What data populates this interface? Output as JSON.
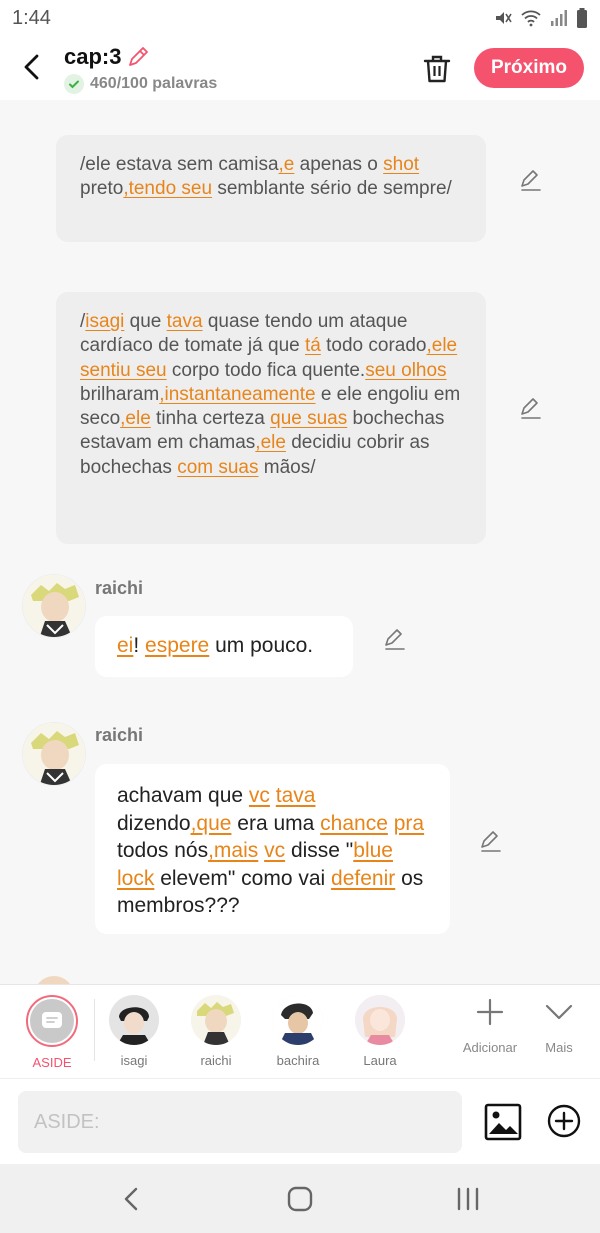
{
  "status_bar": {
    "time": "1:44"
  },
  "header": {
    "title": "cap:3",
    "word_count": "460/100 palavras",
    "next_label": "Próximo"
  },
  "narrations": [
    {
      "segments": [
        {
          "t": "/ele estava sem camisa",
          "h": false
        },
        {
          "t": ",e",
          "h": true
        },
        {
          "t": " apenas o ",
          "h": false
        },
        {
          "t": "shot",
          "h": true
        },
        {
          "t": " preto",
          "h": false
        },
        {
          "t": ",tendo seu",
          "h": true
        },
        {
          "t": " semblante sério de sempre/",
          "h": false
        }
      ]
    },
    {
      "segments": [
        {
          "t": "/",
          "h": false
        },
        {
          "t": "isagi",
          "h": true
        },
        {
          "t": " que ",
          "h": false
        },
        {
          "t": "tava",
          "h": true
        },
        {
          "t": " quase tendo um ataque cardíaco de tomate já que ",
          "h": false
        },
        {
          "t": "tá",
          "h": true
        },
        {
          "t": " todo corado",
          "h": false
        },
        {
          "t": ",ele",
          "h": true
        },
        {
          "t": " ",
          "h": false
        },
        {
          "t": "sentiu seu",
          "h": true
        },
        {
          "t": " corpo todo fica quente.",
          "h": false
        },
        {
          "t": "seu olhos",
          "h": true
        },
        {
          "t": " brilharam",
          "h": false
        },
        {
          "t": ",instantaneamente",
          "h": true
        },
        {
          "t": " e ele engoliu em seco",
          "h": false
        },
        {
          "t": ",ele",
          "h": true
        },
        {
          "t": " tinha certeza ",
          "h": false
        },
        {
          "t": "que suas",
          "h": true
        },
        {
          "t": " bochechas estavam em chamas",
          "h": false
        },
        {
          "t": ",ele",
          "h": true
        },
        {
          "t": " decidiu cobrir as bochechas ",
          "h": false
        },
        {
          "t": "com suas",
          "h": true
        },
        {
          "t": " mãos/",
          "h": false
        }
      ]
    }
  ],
  "messages": [
    {
      "speaker": "raichi",
      "segments": [
        {
          "t": "ei",
          "h": true
        },
        {
          "t": "! ",
          "h": false
        },
        {
          "t": "espere",
          "h": true
        },
        {
          "t": " um pouco.",
          "h": false
        }
      ]
    },
    {
      "speaker": "raichi",
      "segments": [
        {
          "t": "achavam que ",
          "h": false
        },
        {
          "t": "vc",
          "h": true
        },
        {
          "t": " ",
          "h": false
        },
        {
          "t": "tava",
          "h": true
        },
        {
          "t": " dizendo",
          "h": false
        },
        {
          "t": ",que",
          "h": true
        },
        {
          "t": " era uma ",
          "h": false
        },
        {
          "t": "chance",
          "h": true
        },
        {
          "t": " ",
          "h": false
        },
        {
          "t": "pra",
          "h": true
        },
        {
          "t": " todos nós",
          "h": false
        },
        {
          "t": ",mais",
          "h": true
        },
        {
          "t": " ",
          "h": false
        },
        {
          "t": "vc",
          "h": true
        },
        {
          "t": " disse \"",
          "h": false
        },
        {
          "t": "blue",
          "h": true
        },
        {
          "t": " ",
          "h": false
        },
        {
          "t": "lock",
          "h": true
        },
        {
          "t": " elevem\" como vai ",
          "h": false
        },
        {
          "t": "defenir",
          "h": true
        },
        {
          "t": " os membros???",
          "h": false
        }
      ]
    }
  ],
  "characters": [
    {
      "name": "ASIDE"
    },
    {
      "name": "isagi"
    },
    {
      "name": "raichi"
    },
    {
      "name": "bachira"
    },
    {
      "name": "Laura"
    }
  ],
  "tools": {
    "add_label": "Adicionar",
    "more_label": "Mais"
  },
  "input": {
    "placeholder": "ASIDE:"
  },
  "colors": {
    "accent": "#f5526e",
    "highlight": "#e8851a",
    "aside_ring": "#f26a7c"
  }
}
